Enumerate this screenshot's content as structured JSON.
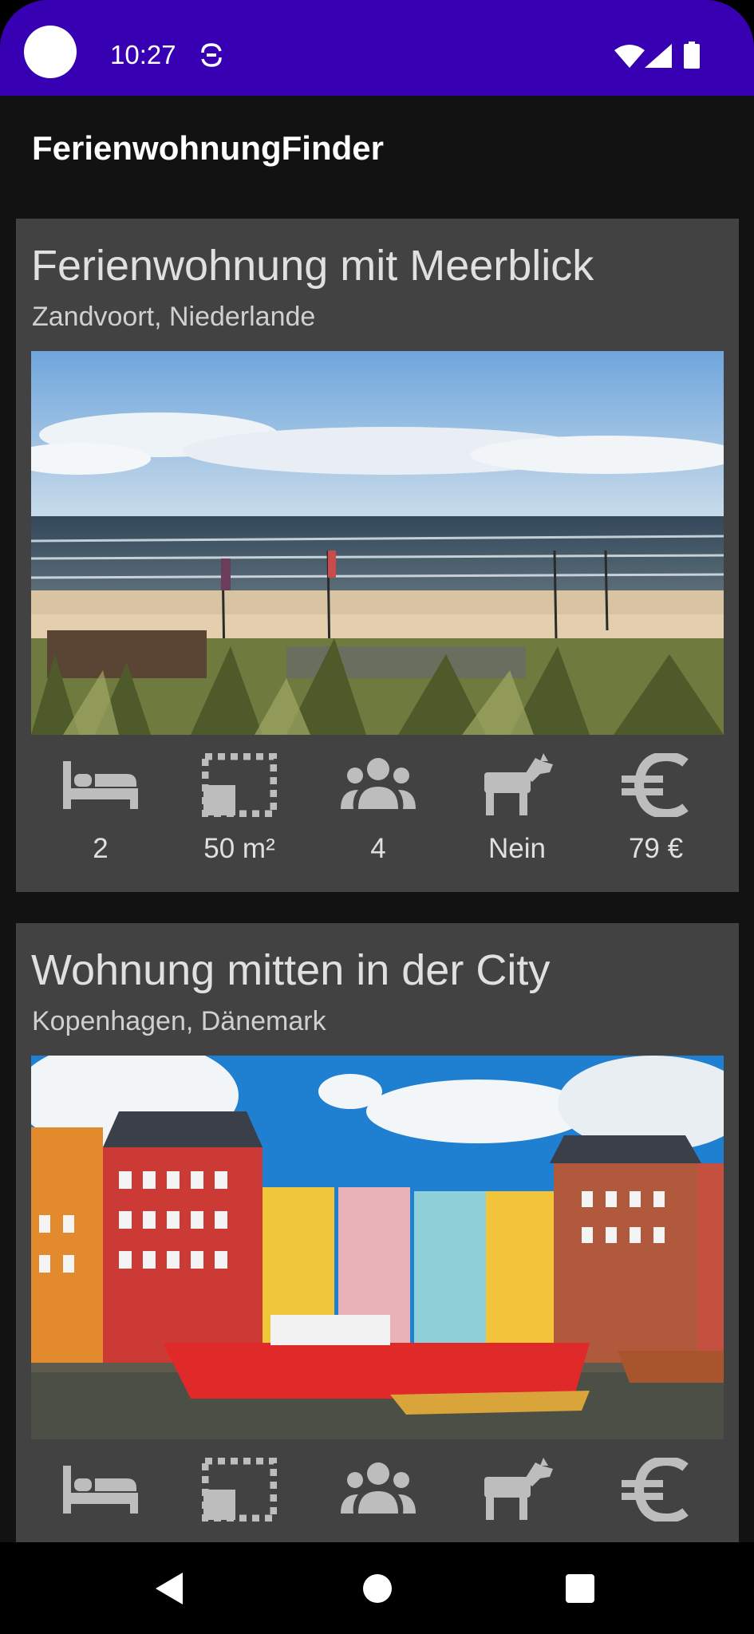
{
  "status_bar": {
    "time": "10:27",
    "icons": [
      "camera-cutout",
      "sync-icon",
      "wifi-icon",
      "signal-icon",
      "battery-icon"
    ],
    "background": "#3700b3"
  },
  "app_bar": {
    "title": "FerienwohnungFinder"
  },
  "listings": [
    {
      "title": "Ferienwohnung mit Meerblick",
      "location": "Zandvoort, Niederlande",
      "image": "beach-photo",
      "features": [
        {
          "icon": "bed-icon",
          "value": "2"
        },
        {
          "icon": "area-icon",
          "value": "50 m²"
        },
        {
          "icon": "people-icon",
          "value": "4"
        },
        {
          "icon": "pet-icon",
          "value": "Nein"
        },
        {
          "icon": "euro-icon",
          "value": "79 €"
        }
      ]
    },
    {
      "title": "Wohnung mitten in der City",
      "location": "Kopenhagen, Dänemark",
      "image": "harbor-photo",
      "features": [
        {
          "icon": "bed-icon",
          "value": ""
        },
        {
          "icon": "area-icon",
          "value": ""
        },
        {
          "icon": "people-icon",
          "value": ""
        },
        {
          "icon": "pet-icon",
          "value": ""
        },
        {
          "icon": "euro-icon",
          "value": ""
        }
      ]
    }
  ],
  "nav_bar": {
    "buttons": [
      "back-icon",
      "home-icon",
      "recents-icon"
    ]
  },
  "colors": {
    "card": "#424242",
    "background": "#121212",
    "icon": "#bdbdbd",
    "text": "#e0e0e0"
  }
}
